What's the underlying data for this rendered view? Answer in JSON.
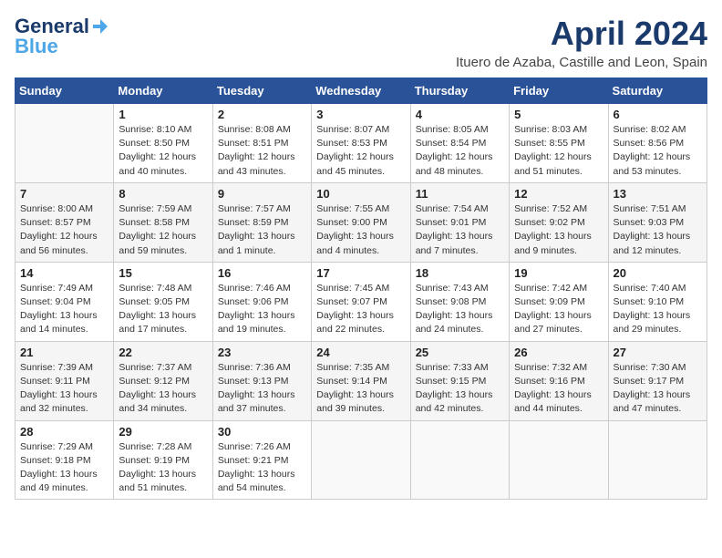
{
  "header": {
    "logo_general": "General",
    "logo_blue": "Blue",
    "month_title": "April 2024",
    "location": "Ituero de Azaba, Castille and Leon, Spain"
  },
  "days_of_week": [
    "Sunday",
    "Monday",
    "Tuesday",
    "Wednesday",
    "Thursday",
    "Friday",
    "Saturday"
  ],
  "weeks": [
    [
      {
        "num": "",
        "info": ""
      },
      {
        "num": "1",
        "info": "Sunrise: 8:10 AM\nSunset: 8:50 PM\nDaylight: 12 hours\nand 40 minutes."
      },
      {
        "num": "2",
        "info": "Sunrise: 8:08 AM\nSunset: 8:51 PM\nDaylight: 12 hours\nand 43 minutes."
      },
      {
        "num": "3",
        "info": "Sunrise: 8:07 AM\nSunset: 8:53 PM\nDaylight: 12 hours\nand 45 minutes."
      },
      {
        "num": "4",
        "info": "Sunrise: 8:05 AM\nSunset: 8:54 PM\nDaylight: 12 hours\nand 48 minutes."
      },
      {
        "num": "5",
        "info": "Sunrise: 8:03 AM\nSunset: 8:55 PM\nDaylight: 12 hours\nand 51 minutes."
      },
      {
        "num": "6",
        "info": "Sunrise: 8:02 AM\nSunset: 8:56 PM\nDaylight: 12 hours\nand 53 minutes."
      }
    ],
    [
      {
        "num": "7",
        "info": "Sunrise: 8:00 AM\nSunset: 8:57 PM\nDaylight: 12 hours\nand 56 minutes."
      },
      {
        "num": "8",
        "info": "Sunrise: 7:59 AM\nSunset: 8:58 PM\nDaylight: 12 hours\nand 59 minutes."
      },
      {
        "num": "9",
        "info": "Sunrise: 7:57 AM\nSunset: 8:59 PM\nDaylight: 13 hours\nand 1 minute."
      },
      {
        "num": "10",
        "info": "Sunrise: 7:55 AM\nSunset: 9:00 PM\nDaylight: 13 hours\nand 4 minutes."
      },
      {
        "num": "11",
        "info": "Sunrise: 7:54 AM\nSunset: 9:01 PM\nDaylight: 13 hours\nand 7 minutes."
      },
      {
        "num": "12",
        "info": "Sunrise: 7:52 AM\nSunset: 9:02 PM\nDaylight: 13 hours\nand 9 minutes."
      },
      {
        "num": "13",
        "info": "Sunrise: 7:51 AM\nSunset: 9:03 PM\nDaylight: 13 hours\nand 12 minutes."
      }
    ],
    [
      {
        "num": "14",
        "info": "Sunrise: 7:49 AM\nSunset: 9:04 PM\nDaylight: 13 hours\nand 14 minutes."
      },
      {
        "num": "15",
        "info": "Sunrise: 7:48 AM\nSunset: 9:05 PM\nDaylight: 13 hours\nand 17 minutes."
      },
      {
        "num": "16",
        "info": "Sunrise: 7:46 AM\nSunset: 9:06 PM\nDaylight: 13 hours\nand 19 minutes."
      },
      {
        "num": "17",
        "info": "Sunrise: 7:45 AM\nSunset: 9:07 PM\nDaylight: 13 hours\nand 22 minutes."
      },
      {
        "num": "18",
        "info": "Sunrise: 7:43 AM\nSunset: 9:08 PM\nDaylight: 13 hours\nand 24 minutes."
      },
      {
        "num": "19",
        "info": "Sunrise: 7:42 AM\nSunset: 9:09 PM\nDaylight: 13 hours\nand 27 minutes."
      },
      {
        "num": "20",
        "info": "Sunrise: 7:40 AM\nSunset: 9:10 PM\nDaylight: 13 hours\nand 29 minutes."
      }
    ],
    [
      {
        "num": "21",
        "info": "Sunrise: 7:39 AM\nSunset: 9:11 PM\nDaylight: 13 hours\nand 32 minutes."
      },
      {
        "num": "22",
        "info": "Sunrise: 7:37 AM\nSunset: 9:12 PM\nDaylight: 13 hours\nand 34 minutes."
      },
      {
        "num": "23",
        "info": "Sunrise: 7:36 AM\nSunset: 9:13 PM\nDaylight: 13 hours\nand 37 minutes."
      },
      {
        "num": "24",
        "info": "Sunrise: 7:35 AM\nSunset: 9:14 PM\nDaylight: 13 hours\nand 39 minutes."
      },
      {
        "num": "25",
        "info": "Sunrise: 7:33 AM\nSunset: 9:15 PM\nDaylight: 13 hours\nand 42 minutes."
      },
      {
        "num": "26",
        "info": "Sunrise: 7:32 AM\nSunset: 9:16 PM\nDaylight: 13 hours\nand 44 minutes."
      },
      {
        "num": "27",
        "info": "Sunrise: 7:30 AM\nSunset: 9:17 PM\nDaylight: 13 hours\nand 47 minutes."
      }
    ],
    [
      {
        "num": "28",
        "info": "Sunrise: 7:29 AM\nSunset: 9:18 PM\nDaylight: 13 hours\nand 49 minutes."
      },
      {
        "num": "29",
        "info": "Sunrise: 7:28 AM\nSunset: 9:19 PM\nDaylight: 13 hours\nand 51 minutes."
      },
      {
        "num": "30",
        "info": "Sunrise: 7:26 AM\nSunset: 9:21 PM\nDaylight: 13 hours\nand 54 minutes."
      },
      {
        "num": "",
        "info": ""
      },
      {
        "num": "",
        "info": ""
      },
      {
        "num": "",
        "info": ""
      },
      {
        "num": "",
        "info": ""
      }
    ]
  ]
}
